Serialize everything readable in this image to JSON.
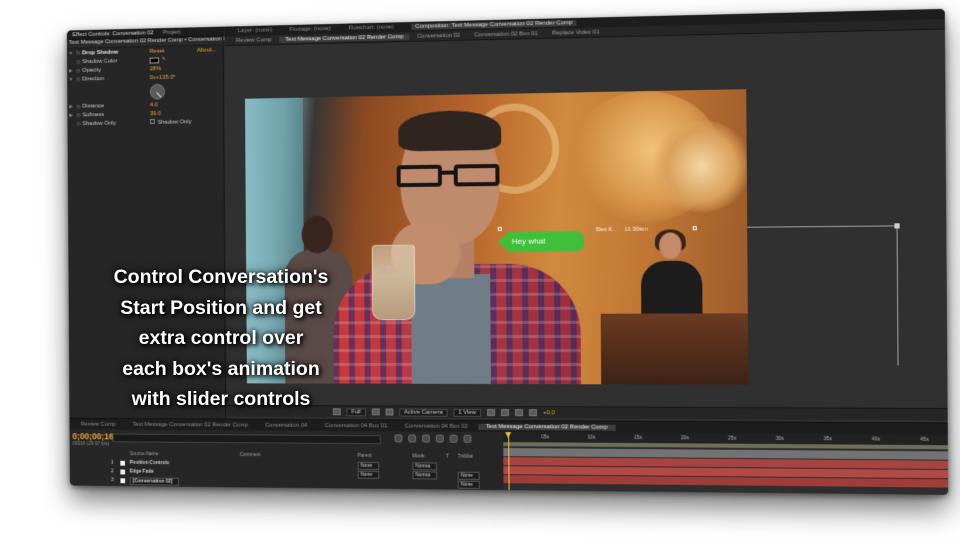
{
  "effect_controls": {
    "tabs": [
      "Effect Controls: Conversation 02",
      "Project"
    ],
    "subtitle": "Text Message Conversation 02 Render Comp • Conversation 02",
    "effect_name": "Drop Shadow",
    "reset_label": "Reset",
    "about_label": "About...",
    "properties": [
      {
        "label": "Shadow Color",
        "value": ""
      },
      {
        "label": "Opacity",
        "value": "28%"
      },
      {
        "label": "Direction",
        "value": "0x+135.0°"
      },
      {
        "label": "Distance",
        "value": "4.0"
      },
      {
        "label": "Softness",
        "value": "39.0"
      },
      {
        "label": "Shadow Only",
        "value": "Shadow Only"
      }
    ]
  },
  "top_tabs": [
    "Layer: (none)",
    "Footage: (none)",
    "Flowchart: (none)",
    "Composition: Text Message Conversation 02 Render Comp"
  ],
  "comp_tabs": [
    "Review Comp",
    "Text Message Conversation 02 Render Comp",
    "Conversation 02",
    "Conversation 02 Box 01",
    "Replace Video 01"
  ],
  "viewer": {
    "bubble_text": "Hey what",
    "sender": "Ben K.",
    "time": "11:30am"
  },
  "viewer_toolbar": {
    "resolution": "Full",
    "camera": "Active Camera",
    "views": "1 View",
    "exposure": "+0.0"
  },
  "timeline": {
    "tabs": [
      "Review Comp",
      "Text Message Conversation 02 Render Comp",
      "Conversation 04",
      "Conversation 04 Box 01",
      "Conversation 04 Box 02",
      "Text Message Conversation 02 Render Comp"
    ],
    "timecode": "0;00;00;16",
    "fps": "00016 (29.97 fps)",
    "search_placeholder": "",
    "col_source": "Source Name",
    "col_comment": "Comment",
    "col_parent": "Parent",
    "col_mode": "Mode",
    "col_t": "T",
    "col_trkmat": "TrkMat",
    "layers": [
      {
        "num": "1",
        "name": "Position Controls",
        "parent": "None",
        "mode": "Norma",
        "trkmat": ""
      },
      {
        "num": "2",
        "name": "Edge Fade",
        "parent": "None",
        "mode": "Norma",
        "trkmat": "None"
      },
      {
        "num": "3",
        "name": "[Conversation 02]",
        "parent": "",
        "mode": "",
        "trkmat": "None"
      }
    ],
    "ruler_ticks": [
      "05s",
      "10s",
      "15s",
      "20s",
      "25s",
      "30s",
      "35s",
      "40s",
      "45s"
    ]
  },
  "caption_lines": [
    "Control Conversation's",
    "Start Position and get",
    "extra control over",
    "each box's animation",
    "with slider controls"
  ]
}
